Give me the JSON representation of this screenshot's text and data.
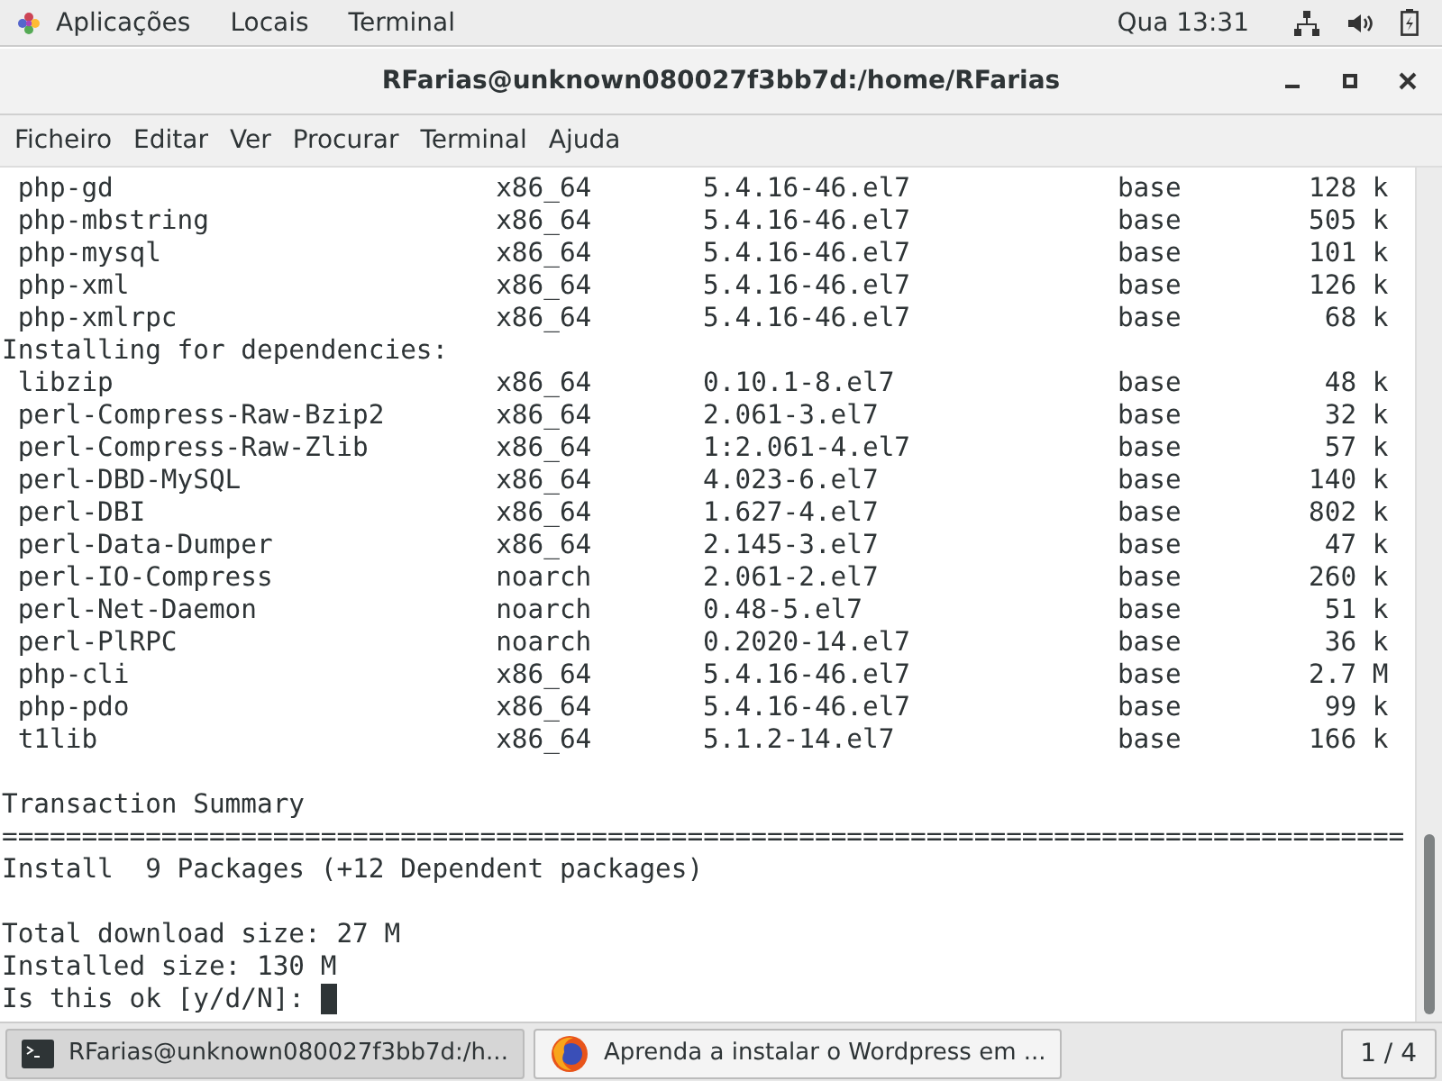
{
  "top_bar": {
    "menus": [
      "Aplicações",
      "Locais",
      "Terminal"
    ],
    "clock": "Qua 13:31"
  },
  "window": {
    "title": "RFarias@unknown080027f3bb7d:/home/RFarias"
  },
  "menu_bar": [
    "Ficheiro",
    "Editar",
    "Ver",
    "Procurar",
    "Terminal",
    "Ajuda"
  ],
  "terminal": {
    "packages": [
      {
        "name": "php-gd",
        "arch": "x86_64",
        "version": "5.4.16-46.el7",
        "repo": "base",
        "size": "128 k"
      },
      {
        "name": "php-mbstring",
        "arch": "x86_64",
        "version": "5.4.16-46.el7",
        "repo": "base",
        "size": "505 k"
      },
      {
        "name": "php-mysql",
        "arch": "x86_64",
        "version": "5.4.16-46.el7",
        "repo": "base",
        "size": "101 k"
      },
      {
        "name": "php-xml",
        "arch": "x86_64",
        "version": "5.4.16-46.el7",
        "repo": "base",
        "size": "126 k"
      },
      {
        "name": "php-xmlrpc",
        "arch": "x86_64",
        "version": "5.4.16-46.el7",
        "repo": "base",
        "size": "68 k"
      }
    ],
    "dependencies_heading": "Installing for dependencies:",
    "dependencies": [
      {
        "name": "libzip",
        "arch": "x86_64",
        "version": "0.10.1-8.el7",
        "repo": "base",
        "size": "48 k"
      },
      {
        "name": "perl-Compress-Raw-Bzip2",
        "arch": "x86_64",
        "version": "2.061-3.el7",
        "repo": "base",
        "size": "32 k"
      },
      {
        "name": "perl-Compress-Raw-Zlib",
        "arch": "x86_64",
        "version": "1:2.061-4.el7",
        "repo": "base",
        "size": "57 k"
      },
      {
        "name": "perl-DBD-MySQL",
        "arch": "x86_64",
        "version": "4.023-6.el7",
        "repo": "base",
        "size": "140 k"
      },
      {
        "name": "perl-DBI",
        "arch": "x86_64",
        "version": "1.627-4.el7",
        "repo": "base",
        "size": "802 k"
      },
      {
        "name": "perl-Data-Dumper",
        "arch": "x86_64",
        "version": "2.145-3.el7",
        "repo": "base",
        "size": "47 k"
      },
      {
        "name": "perl-IO-Compress",
        "arch": "noarch",
        "version": "2.061-2.el7",
        "repo": "base",
        "size": "260 k"
      },
      {
        "name": "perl-Net-Daemon",
        "arch": "noarch",
        "version": "0.48-5.el7",
        "repo": "base",
        "size": "51 k"
      },
      {
        "name": "perl-PlRPC",
        "arch": "noarch",
        "version": "0.2020-14.el7",
        "repo": "base",
        "size": "36 k"
      },
      {
        "name": "php-cli",
        "arch": "x86_64",
        "version": "5.4.16-46.el7",
        "repo": "base",
        "size": "2.7 M"
      },
      {
        "name": "php-pdo",
        "arch": "x86_64",
        "version": "5.4.16-46.el7",
        "repo": "base",
        "size": "99 k"
      },
      {
        "name": "t1lib",
        "arch": "x86_64",
        "version": "5.1.2-14.el7",
        "repo": "base",
        "size": "166 k"
      }
    ],
    "summary_heading": "Transaction Summary",
    "separator": "========================================================================================",
    "install_line": "Install  9 Packages (+12 Dependent packages)",
    "total_download": "Total download size: 27 M",
    "installed_size": "Installed size: 130 M",
    "prompt": "Is this ok [y/d/N]: "
  },
  "taskbar": {
    "items": [
      {
        "kind": "terminal",
        "label": "RFarias@unknown080027f3bb7d:/h...",
        "selected": true
      },
      {
        "kind": "browser",
        "label": "Aprenda a instalar o Wordpress em ...",
        "selected": false
      }
    ],
    "workspace": "1 / 4"
  }
}
